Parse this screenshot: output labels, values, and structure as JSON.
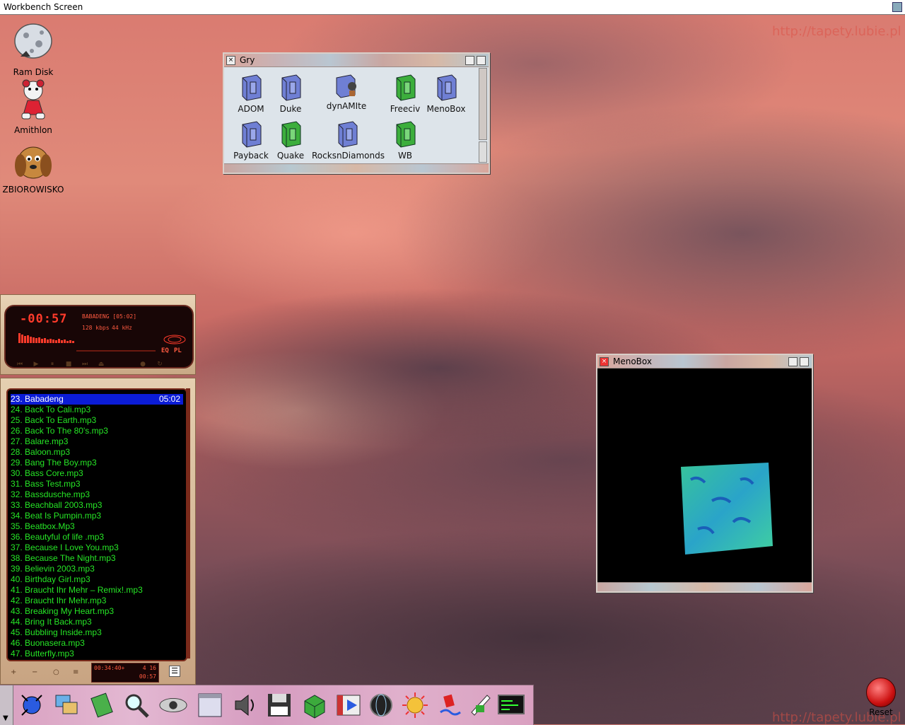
{
  "screen": {
    "title": "Workbench Screen"
  },
  "watermark": "http://tapety.lubie.pl",
  "desktop_icons": [
    {
      "label": "Ram Disk"
    },
    {
      "label": "Amithlon"
    },
    {
      "label": "ZBIOROWISKO"
    }
  ],
  "gry_window": {
    "title": "Gry",
    "icons": [
      {
        "label": "ADOM"
      },
      {
        "label": "Duke"
      },
      {
        "label": "dynAMIte"
      },
      {
        "label": "Freeciv"
      },
      {
        "label": "MenoBox"
      },
      {
        "label": "Payback"
      },
      {
        "label": "Quake"
      },
      {
        "label": "RocksnDiamonds"
      },
      {
        "label": "WB"
      }
    ]
  },
  "menobox_window": {
    "title": "MenoBox"
  },
  "player": {
    "time": "-00:57",
    "song": "BABADENG [05:02]",
    "kbps": "128 kbps",
    "khz": "44 kHz",
    "eq_label": "EQ",
    "pl_label": "PL"
  },
  "playlist": {
    "selected": {
      "title": "23. Babadeng",
      "duration": "05:02"
    },
    "items": [
      "24. Back To Cali.mp3",
      "25. Back To Earth.mp3",
      "26. Back To The 80's.mp3",
      "27. Balare.mp3",
      "28. Baloon.mp3",
      "29. Bang The Boy.mp3",
      "30. Bass Core.mp3",
      "31. Bass Test.mp3",
      "32. Bassdusche.mp3",
      "33. Beachball 2003.mp3",
      "34. Beat Is Pumpin.mp3",
      "35. Beatbox.Mp3",
      "36. Beautyful of life .mp3",
      "37. Because I Love You.mp3",
      "38. Because The Night.mp3",
      "39. Believin 2003.mp3",
      "40. Birthday Girl.mp3",
      "41. Braucht Ihr Mehr – Remix!.mp3",
      "42. Braucht Ihr Mehr.mp3",
      "43. Breaking My Heart.mp3",
      "44. Bring It Back.mp3",
      "45. Bubbling Inside.mp3",
      "46. Buonasera.mp3",
      "47. Butterfly.mp3"
    ],
    "total_time": "00:34:40+",
    "count": "4 16",
    "remaining": "00:57"
  },
  "dock": {
    "items": [
      "weather-icon",
      "windows-icon",
      "notepad-icon",
      "magnifier-icon",
      "eye-icon",
      "terminal-window-icon",
      "speaker-icon",
      "floppy-disk-icon",
      "green-cube-icon",
      "movie-player-icon",
      "globe-icon",
      "sun-face-icon",
      "paint-icon",
      "document-icon",
      "shell-icon"
    ]
  },
  "reset": {
    "label": "Reset"
  },
  "colors": {
    "playlist_text": "#26e626",
    "playlist_selection": "#0b1cd6",
    "player_led": "#ff3b2b"
  }
}
